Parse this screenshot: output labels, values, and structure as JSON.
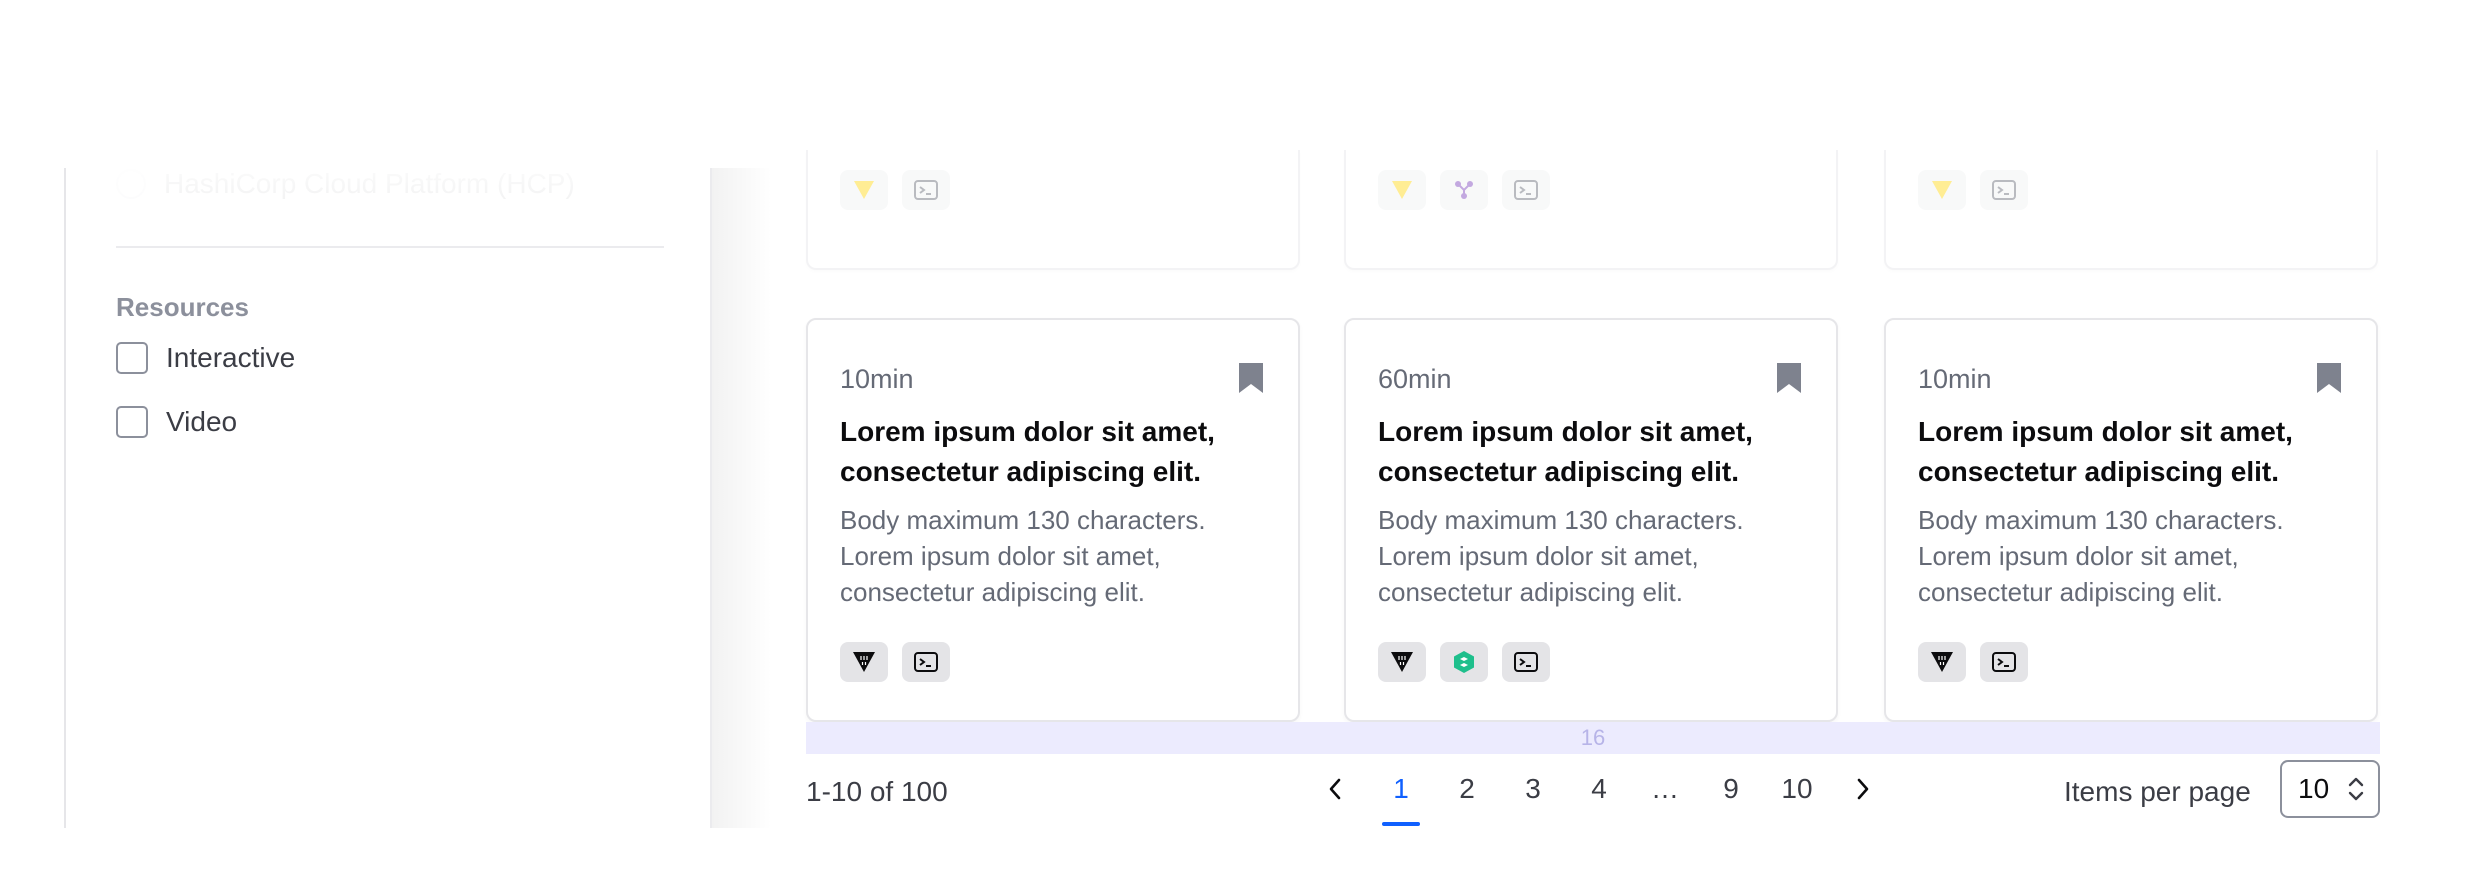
{
  "sidebar": {
    "faded_option": "HashiCorp Cloud Platform (HCP)",
    "resources_title": "Resources",
    "resources": [
      {
        "label": "Interactive"
      },
      {
        "label": "Video"
      }
    ]
  },
  "cards": [
    {
      "duration": "10min",
      "title": "Lorem ipsum dolor sit amet, consectetur adipiscing elit.",
      "body": "Body maximum 130 characters. Lorem ipsum dolor sit amet, consectetur adipiscing elit.",
      "products": [
        "vault-icon",
        "terminal-icon"
      ]
    },
    {
      "duration": "60min",
      "title": "Lorem ipsum dolor sit amet, consectetur adipiscing elit.",
      "body": "Body maximum 130 characters. Lorem ipsum dolor sit amet, consectetur adipiscing elit.",
      "products": [
        "vault-icon",
        "consul-icon",
        "terminal-icon"
      ]
    },
    {
      "duration": "10min",
      "title": "Lorem ipsum dolor sit amet, consectetur adipiscing elit.",
      "body": "Body maximum 130 characters. Lorem ipsum dolor sit amet, consectetur adipiscing elit.",
      "products": [
        "vault-icon",
        "terminal-icon"
      ]
    }
  ],
  "spacer_label": "16",
  "pagination": {
    "range": "1-10 of 100",
    "pages": [
      "1",
      "2",
      "3",
      "4",
      "…",
      "9",
      "10"
    ],
    "current": "1",
    "items_per_page_label": "Items per page",
    "items_per_page_value": "10"
  },
  "colors": {
    "accent": "#1060ff",
    "vault_yellow": "#ffd814",
    "consul_green": "#1ebf8c",
    "text_muted": "#656a76",
    "spacer": "#ecebfe"
  }
}
